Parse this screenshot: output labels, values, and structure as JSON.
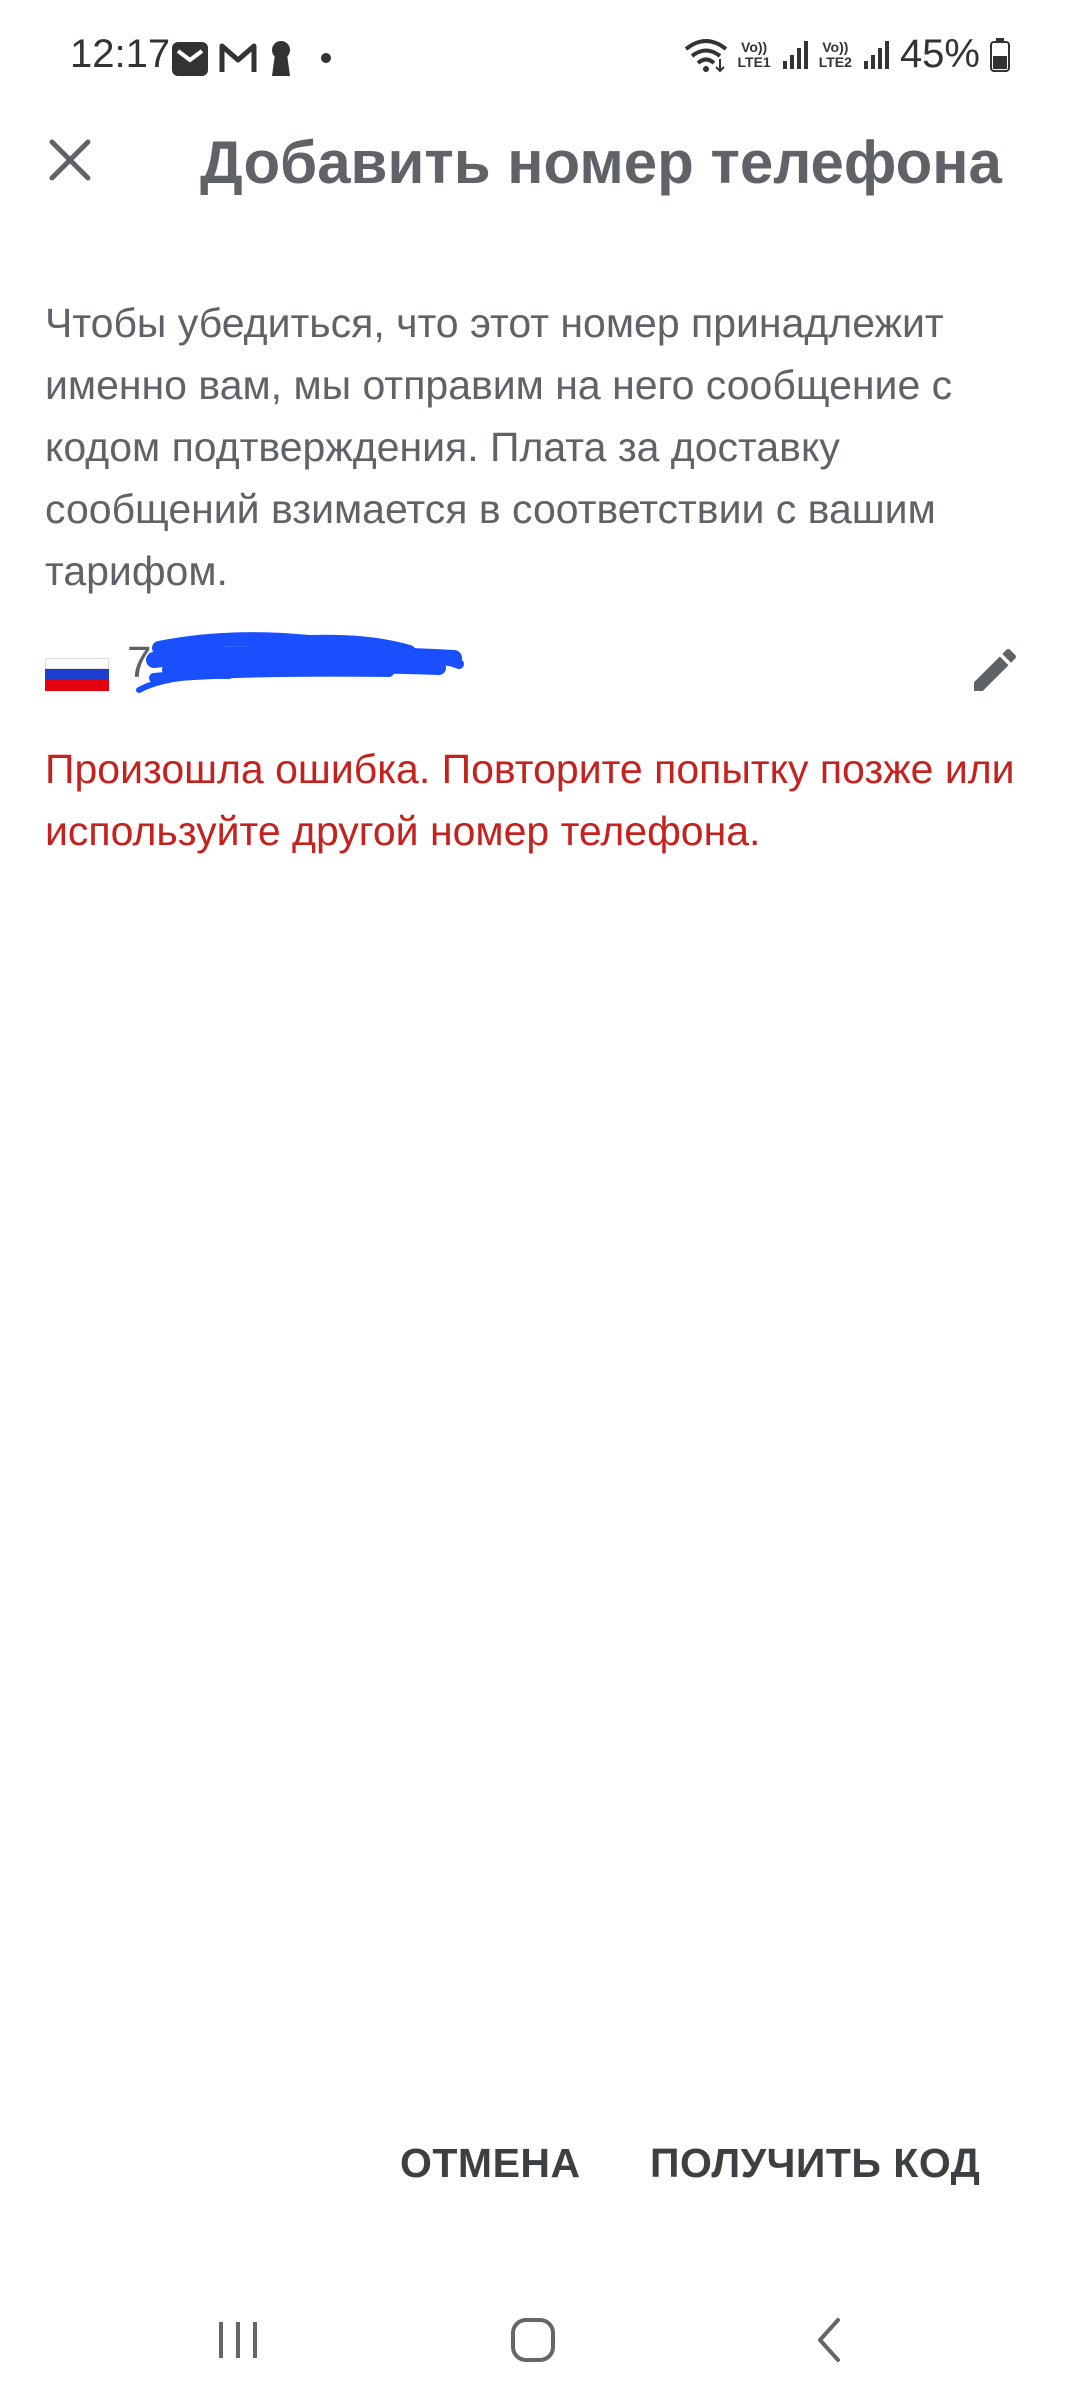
{
  "status_bar": {
    "time": "12:17",
    "lte1": "LTE1",
    "lte2": "LTE2",
    "volte": "Vo))",
    "battery_percent": "45%"
  },
  "header": {
    "title": "Добавить номер телефона"
  },
  "description": "Чтобы убедиться, что этот номер принадлежит именно вам, мы отправим на него сообщение с кодом подтверждения. Плата за доставку сообщений взимается в соответствии с вашим тарифом.",
  "phone": {
    "country": "Russia",
    "number_prefix": "7"
  },
  "error_message": "Произошла ошибка. Повторите попытку позже или используйте другой номер телефона.",
  "actions": {
    "cancel_label": "ОТМЕНА",
    "get_code_label": "ПОЛУЧИТЬ КОД"
  },
  "colors": {
    "error": "#c5221f",
    "text": "#5f6368",
    "redaction": "#1a4fff"
  }
}
